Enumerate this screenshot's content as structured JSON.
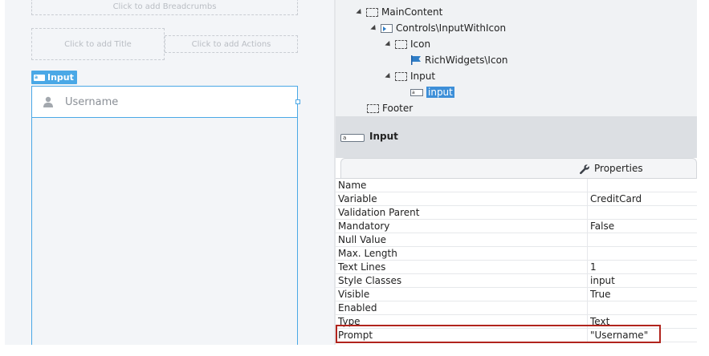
{
  "canvas": {
    "breadcrumbs_placeholder": "Click to add Breadcrumbs",
    "title_placeholder": "Click to add Title",
    "actions_placeholder": "Click to add Actions",
    "widget_tag_label": "Input",
    "input_placeholder": "Username",
    "input_icon": "user-icon"
  },
  "tree": {
    "items": [
      {
        "label": "MainContent",
        "icon": "container-icon"
      },
      {
        "label": "Controls\\InputWithIcon",
        "icon": "block-icon"
      },
      {
        "label": "Icon",
        "icon": "container-icon"
      },
      {
        "label": "RichWidgets\\Icon",
        "icon": "flag-icon"
      },
      {
        "label": "Input",
        "icon": "container-icon"
      },
      {
        "label": "input",
        "icon": "input-icon",
        "selected": true
      },
      {
        "label": "Footer",
        "icon": "container-icon"
      }
    ]
  },
  "selection": {
    "title": "Input"
  },
  "properties": {
    "tab_label": "Properties",
    "rows": [
      {
        "name": "Name",
        "value": ""
      },
      {
        "name": "Variable",
        "value": "CreditCard"
      },
      {
        "name": "Validation Parent",
        "value": ""
      },
      {
        "name": "Mandatory",
        "value": "False"
      },
      {
        "name": "Null Value",
        "value": ""
      },
      {
        "name": "Max. Length",
        "value": ""
      },
      {
        "name": "Text Lines",
        "value": "1"
      },
      {
        "name": "Style Classes",
        "value": "input"
      },
      {
        "name": "Visible",
        "value": "True"
      },
      {
        "name": "Enabled",
        "value": ""
      },
      {
        "name": "Type",
        "value": "Text"
      },
      {
        "name": "Prompt",
        "value": "\"Username\""
      }
    ]
  },
  "colors": {
    "accent": "#4aa8e6",
    "highlight": "#b1241d",
    "selection": "#3d8fd8"
  }
}
